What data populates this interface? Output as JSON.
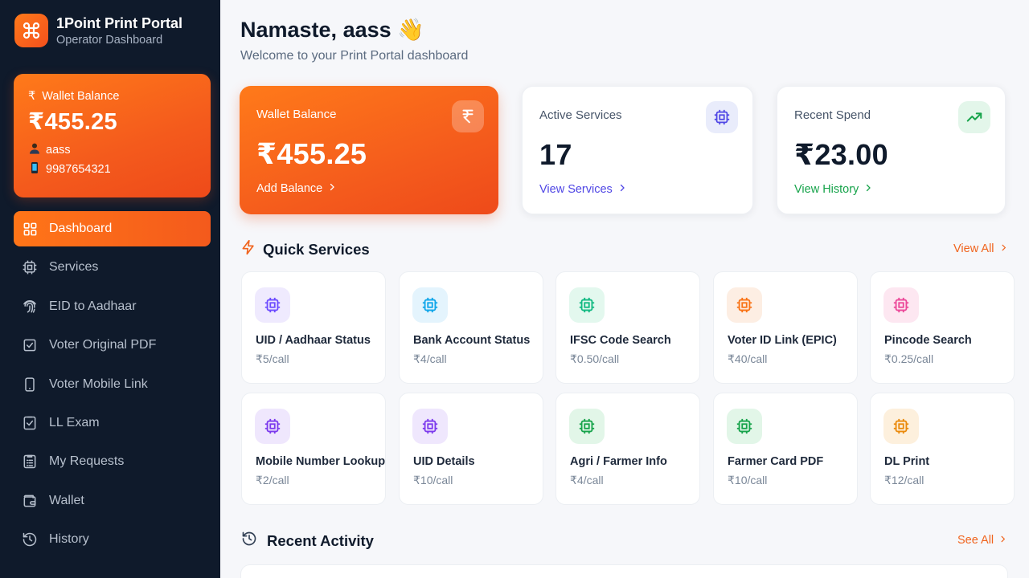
{
  "brand": {
    "title": "1Point Print Portal",
    "subtitle": "Operator Dashboard"
  },
  "sidebar_wallet": {
    "label": "Wallet Balance",
    "amount": "₹455.25",
    "user": "aass",
    "phone": "9987654321"
  },
  "nav": [
    {
      "label": "Dashboard",
      "icon": "grid-icon",
      "active": true
    },
    {
      "label": "Services",
      "icon": "chip-icon"
    },
    {
      "label": "EID to Aadhaar",
      "icon": "fingerprint-icon"
    },
    {
      "label": "Voter Original PDF",
      "icon": "check-square-icon"
    },
    {
      "label": "Voter Mobile Link",
      "icon": "mobile-icon"
    },
    {
      "label": "LL Exam",
      "icon": "clipboard-check-icon"
    },
    {
      "label": "My Requests",
      "icon": "list-icon"
    },
    {
      "label": "Wallet",
      "icon": "wallet-icon"
    },
    {
      "label": "History",
      "icon": "history-icon"
    }
  ],
  "greeting": {
    "title": "Namaste, aass 👋",
    "subtitle": "Welcome to your Print Portal dashboard"
  },
  "stats": {
    "wallet": {
      "label": "Wallet Balance",
      "value": "₹455.25",
      "link": "Add Balance"
    },
    "services": {
      "label": "Active Services",
      "value": "17",
      "link": "View Services"
    },
    "spend": {
      "label": "Recent Spend",
      "value": "₹23.00",
      "link": "View History"
    }
  },
  "quick_services": {
    "title": "Quick Services",
    "view_all": "View All",
    "items": [
      {
        "name": "UID / Aadhaar Status",
        "price": "₹5/call",
        "color": "#6d4cff",
        "bg": "#efeafe"
      },
      {
        "name": "Bank Account Status",
        "price": "₹4/call",
        "color": "#0ea5e9",
        "bg": "#e4f4fd"
      },
      {
        "name": "IFSC Code Search",
        "price": "₹0.50/call",
        "color": "#10b981",
        "bg": "#e3f8ee"
      },
      {
        "name": "Voter ID Link (EPIC)",
        "price": "₹40/call",
        "color": "#f97316",
        "bg": "#fdeee3"
      },
      {
        "name": "Pincode Search",
        "price": "₹0.25/call",
        "color": "#ec4899",
        "bg": "#fde7f1"
      },
      {
        "name": "Mobile Number Lookup",
        "price": "₹2/call",
        "color": "#7c3aed",
        "bg": "#efe7fd"
      },
      {
        "name": "UID Details",
        "price": "₹10/call",
        "color": "#7c3aed",
        "bg": "#efe7fd"
      },
      {
        "name": "Agri / Farmer Info",
        "price": "₹4/call",
        "color": "#16a34a",
        "bg": "#e2f6e8"
      },
      {
        "name": "Farmer Card PDF",
        "price": "₹10/call",
        "color": "#16a34a",
        "bg": "#e2f6e8"
      },
      {
        "name": "DL Print",
        "price": "₹12/call",
        "color": "#ea8a0c",
        "bg": "#fdf0dd"
      }
    ]
  },
  "recent_activity": {
    "title": "Recent Activity",
    "see_all": "See All"
  },
  "colors": {
    "accent": "#f45a1c",
    "sidebar": "#0f1a2b",
    "link_blue": "#4f46e5",
    "link_green": "#16a34a"
  }
}
